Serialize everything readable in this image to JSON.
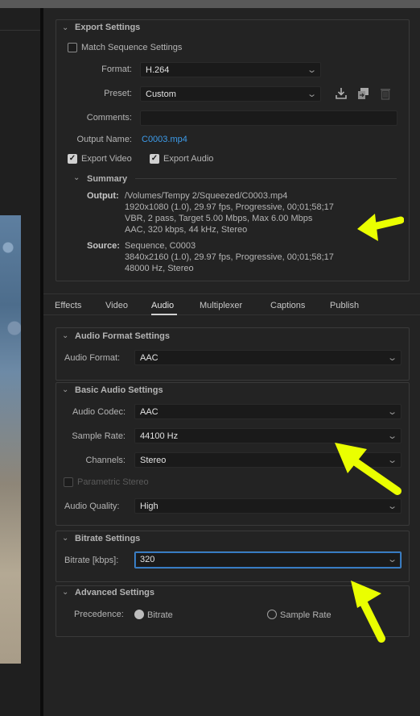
{
  "export_settings": {
    "title": "Export Settings",
    "match_sequence_label": "Match Sequence Settings",
    "format_label": "Format:",
    "format_value": "H.264",
    "preset_label": "Preset:",
    "preset_value": "Custom",
    "comments_label": "Comments:",
    "comments_value": "",
    "output_name_label": "Output Name:",
    "output_name_value": "C0003.mp4",
    "export_video_label": "Export Video",
    "export_audio_label": "Export Audio",
    "export_video_checked": true,
    "export_audio_checked": true,
    "match_sequence_checked": false
  },
  "summary": {
    "title": "Summary",
    "output_label": "Output:",
    "output_lines": [
      "/Volumes/Tempy 2/Squeezed/C0003.mp4",
      "1920x1080 (1.0), 29.97 fps, Progressive, 00;01;58;17",
      "VBR, 2 pass, Target 5.00 Mbps, Max 6.00 Mbps",
      "AAC, 320 kbps, 44 kHz, Stereo"
    ],
    "source_label": "Source:",
    "source_lines": [
      "Sequence, C0003",
      "3840x2160 (1.0), 29.97 fps, Progressive, 00;01;58;17",
      "48000 Hz, Stereo"
    ]
  },
  "tabs": [
    "Effects",
    "Video",
    "Audio",
    "Multiplexer",
    "Captions",
    "Publish"
  ],
  "active_tab": "Audio",
  "audio_format": {
    "title": "Audio Format Settings",
    "label": "Audio Format:",
    "value": "AAC"
  },
  "basic_audio": {
    "title": "Basic Audio Settings",
    "codec_label": "Audio Codec:",
    "codec_value": "AAC",
    "sample_rate_label": "Sample Rate:",
    "sample_rate_value": "44100 Hz",
    "channels_label": "Channels:",
    "channels_value": "Stereo",
    "parametric_label": "Parametric Stereo",
    "parametric_checked": false,
    "quality_label": "Audio Quality:",
    "quality_value": "High"
  },
  "bitrate": {
    "title": "Bitrate Settings",
    "label": "Bitrate [kbps]:",
    "value": "320"
  },
  "advanced": {
    "title": "Advanced Settings",
    "precedence_label": "Precedence:",
    "option_bitrate": "Bitrate",
    "option_sample_rate": "Sample Rate",
    "selected": "Bitrate"
  },
  "colors": {
    "accent_link": "#3d9be9",
    "focus_border": "#4a8fd4",
    "annotation_arrow": "#eaff00",
    "panel_bg": "#232323"
  },
  "icons": {
    "collapse": "chevron-down-icon",
    "dropdown": "chevron-down-icon",
    "save_preset": "download-icon",
    "import_preset": "import-icon",
    "delete_preset": "trash-icon"
  }
}
